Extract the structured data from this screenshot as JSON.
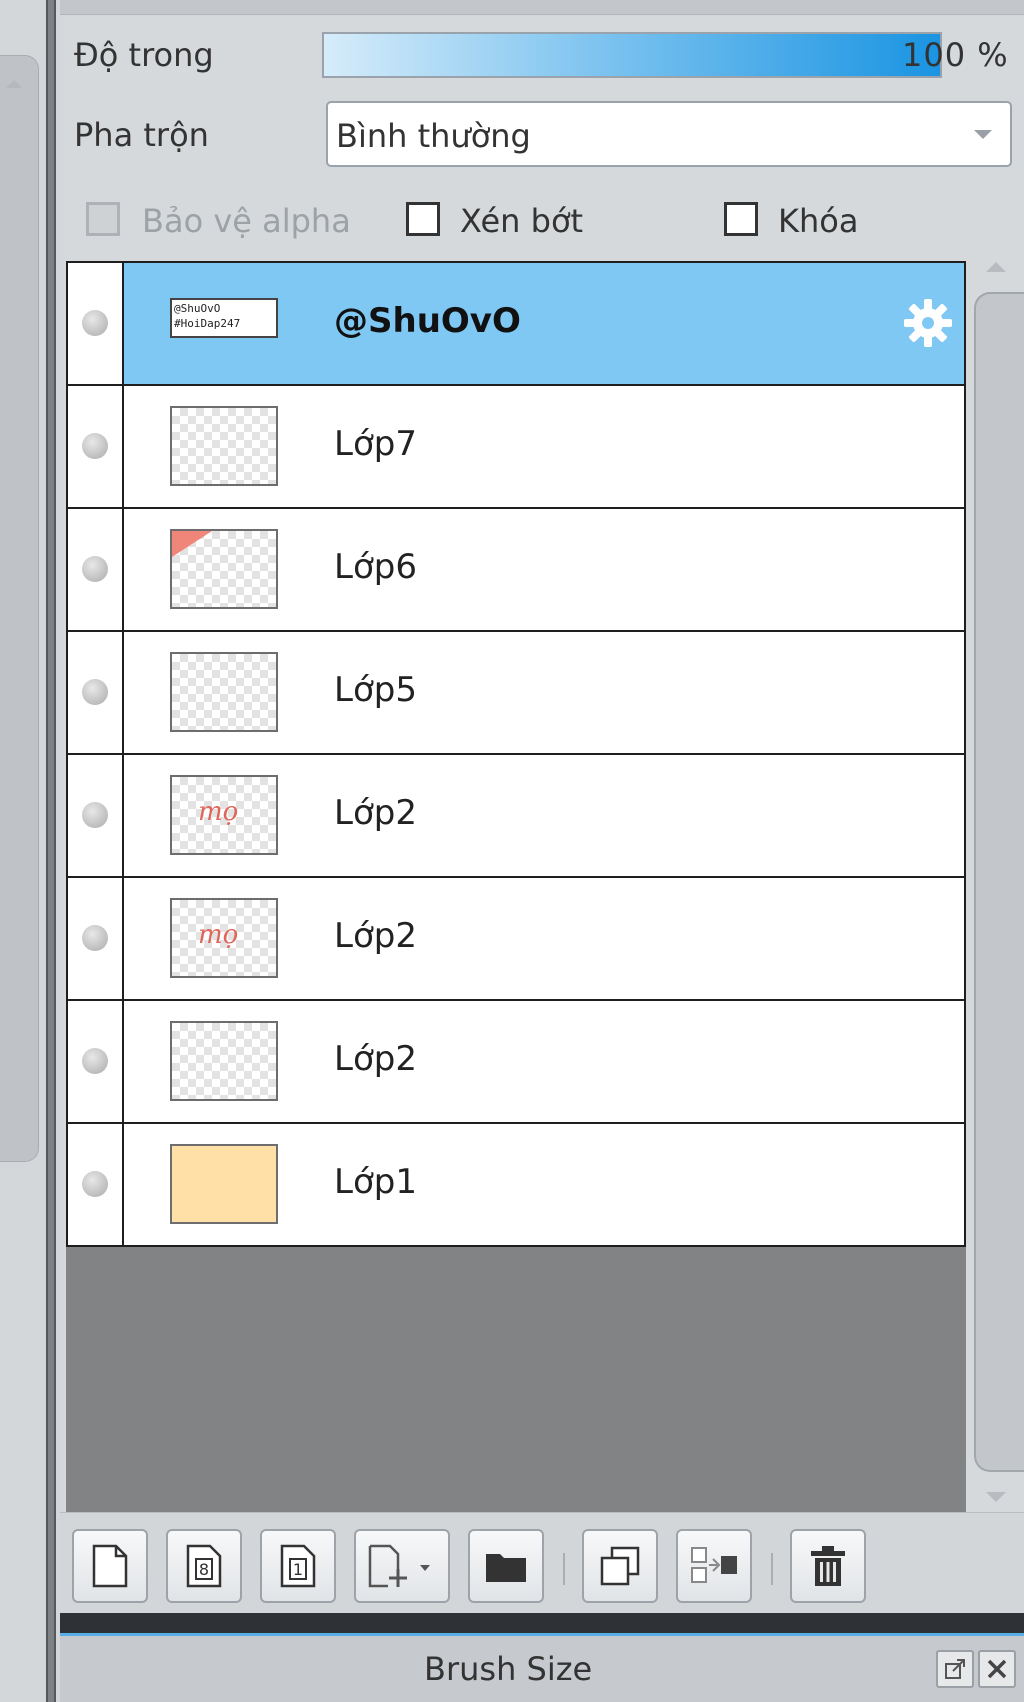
{
  "properties": {
    "opacity_label": "Độ trong",
    "opacity_value": "100 %",
    "opacity_fraction": 1.0,
    "blend_label": "Pha trộn",
    "blend_value": "Bình thường",
    "protect_alpha_label": "Bảo vệ alpha",
    "clip_label": "Xén bớt",
    "lock_label": "Khóa"
  },
  "layers": [
    {
      "name": "@ShuOvO",
      "selected": true,
      "thumb_text": [
        "@ShuOvO",
        "#HoiDap247"
      ]
    },
    {
      "name": "Lớp7"
    },
    {
      "name": "Lớp6"
    },
    {
      "name": "Lớp5"
    },
    {
      "name": "Lớp2",
      "thumb_text": [
        "mọ"
      ]
    },
    {
      "name": "Lớp2",
      "thumb_text": [
        "mọ"
      ]
    },
    {
      "name": "Lớp2"
    },
    {
      "name": "Lớp1"
    }
  ],
  "toolbar": {
    "buttons": [
      "new-layer-icon",
      "new-8bit-layer-icon",
      "new-1bit-layer-icon",
      "add-layer-menu-icon",
      "folder-icon",
      "duplicate-icon",
      "merge-down-icon",
      "delete-icon"
    ]
  },
  "bottom_panel": {
    "title": "Brush Size"
  },
  "colors": {
    "selected_row": "#7fc8f3",
    "opacity_bar_end": "#1a94e2",
    "panel_bg": "#d6d9dc"
  }
}
